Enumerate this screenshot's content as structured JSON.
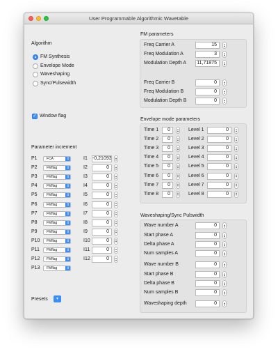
{
  "window": {
    "title": "User Programmable Algorithmic Wavetable"
  },
  "algorithm": {
    "title": "Algorithm",
    "options": [
      "FM Synthesis",
      "Envelope Mode",
      "Waveshaping",
      "Sync/Pulsewidth"
    ],
    "selected": "FM Synthesis"
  },
  "window_flag": {
    "label": "Window flag",
    "checked": true
  },
  "param_increment": {
    "title": "Parameter increment",
    "p_labels": [
      "P1",
      "P2",
      "P3",
      "P4",
      "P5",
      "P6",
      "P7",
      "P8",
      "P9",
      "P10",
      "P11",
      "P12",
      "P13"
    ],
    "p_values": [
      "FCA",
      "FMflag",
      "FMflag",
      "FMflag",
      "FMflag",
      "FMflag",
      "FMflag",
      "FMflag",
      "FMflag",
      "FMflag",
      "FMflag",
      "FMflag",
      "FMflag"
    ],
    "i_labels": [
      "I1",
      "I2",
      "I3",
      "I4",
      "I5",
      "I6",
      "I7",
      "I8",
      "I9",
      "I10",
      "I11",
      "I12"
    ],
    "i_values": [
      "-0,21093",
      "0",
      "0",
      "0",
      "0",
      "0",
      "0",
      "0",
      "0",
      "0",
      "0",
      "0"
    ]
  },
  "presets": {
    "label": "Presets"
  },
  "fm": {
    "title": "FM parameters",
    "rows": [
      {
        "label": "Freq Carrier A",
        "value": "15"
      },
      {
        "label": "Freq Modulation A",
        "value": "3"
      },
      {
        "label": "Modulation Depth A",
        "value": "11,71875"
      },
      {
        "label": "Freq Carrier B",
        "value": "0"
      },
      {
        "label": "Freq Modulation B",
        "value": "0"
      },
      {
        "label": "Modulation Depth B",
        "value": "0"
      }
    ]
  },
  "envelope": {
    "title": "Envelope mode parameters",
    "rows": [
      {
        "time_label": "Time 1",
        "time_value": "0",
        "level_label": "Level 1",
        "level_value": "0"
      },
      {
        "time_label": "Time 2",
        "time_value": "0",
        "level_label": "Level 2",
        "level_value": "0"
      },
      {
        "time_label": "Time 3",
        "time_value": "0",
        "level_label": "Level 3",
        "level_value": "0"
      },
      {
        "time_label": "Time 4",
        "time_value": "0",
        "level_label": "Level 4",
        "level_value": "0"
      },
      {
        "time_label": "Time 5",
        "time_value": "0",
        "level_label": "Level 5",
        "level_value": "0"
      },
      {
        "time_label": "Time 6",
        "time_value": "0",
        "level_label": "Level 6",
        "level_value": "0"
      },
      {
        "time_label": "Time 7",
        "time_value": "0",
        "level_label": "Level 7",
        "level_value": "0"
      },
      {
        "time_label": "Time 8",
        "time_value": "0",
        "level_label": "Level 8",
        "level_value": "0"
      }
    ]
  },
  "waveshaping": {
    "title": "Waveshaping/Sync Pulswidth",
    "rows": [
      {
        "label": "Wave number A",
        "value": "0"
      },
      {
        "label": "Start phase A",
        "value": "0"
      },
      {
        "label": "Delta phase A",
        "value": "0"
      },
      {
        "label": "Num samples  A",
        "value": "0"
      },
      {
        "label": "Wave number B",
        "value": "0"
      },
      {
        "label": "Start phase B",
        "value": "0"
      },
      {
        "label": "Delta phase B",
        "value": "0"
      },
      {
        "label": "Num samples  B",
        "value": "0"
      },
      {
        "label": "Waveshaping depth",
        "value": "0"
      }
    ]
  },
  "colors": {
    "accent": "#3b8df7",
    "window_bg": "#ececec",
    "group_bg": "#e3e3e3"
  },
  "icons": {
    "popup_arrow": "chevron-updown-icon",
    "stepper": "stepper-arrows-icon"
  }
}
